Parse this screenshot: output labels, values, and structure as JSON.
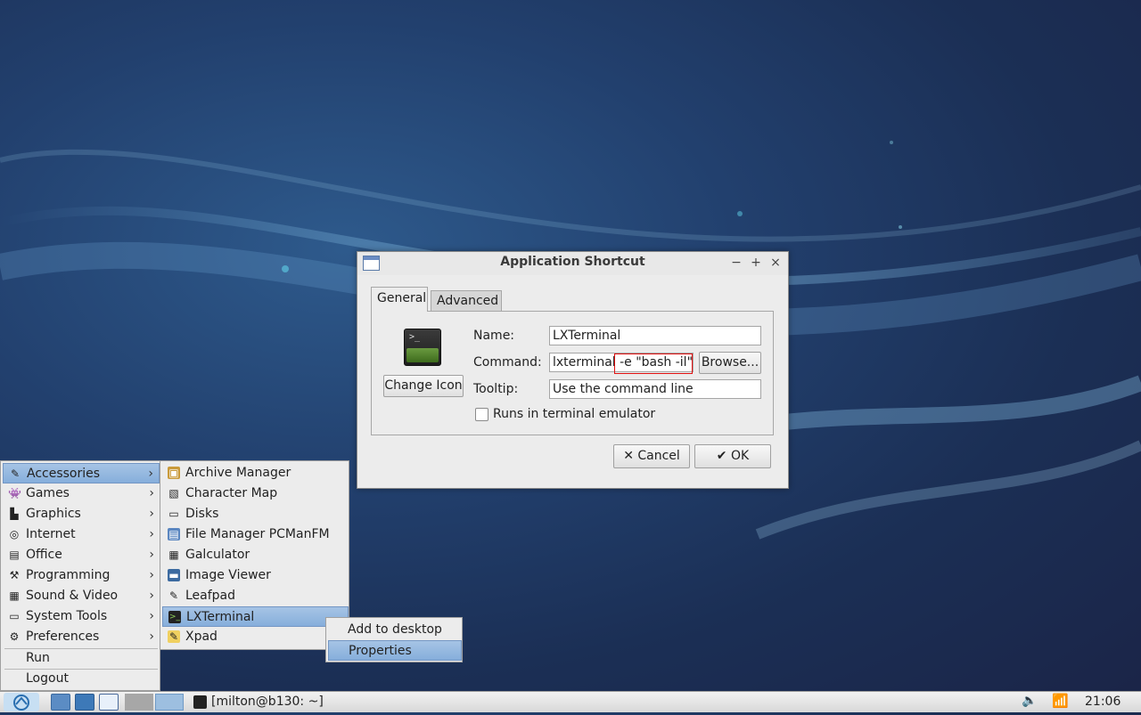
{
  "dialog": {
    "title": "Application Shortcut",
    "controls": {
      "minimize": "−",
      "maximize": "+",
      "close": "×"
    },
    "tabs": [
      {
        "label": "General"
      },
      {
        "label": "Advanced"
      }
    ],
    "change_icon_label": "Change Icon",
    "name_label": "Name:",
    "name_value": "LXTerminal",
    "command_label": "Command:",
    "command_value": "lxterminal -e \"bash -il\"",
    "browse_label": "Browse...",
    "tooltip_label": "Tooltip:",
    "tooltip_value": "Use the command line",
    "run_in_terminal_label": "Runs in terminal emulator",
    "run_in_terminal_checked": false,
    "cancel_label": "Cancel",
    "ok_label": "OK",
    "icon_prompt": ">_"
  },
  "main_menu": {
    "items": [
      {
        "label": "Accessories",
        "icon": "accessories-icon"
      },
      {
        "label": "Games",
        "icon": "games-icon"
      },
      {
        "label": "Graphics",
        "icon": "graphics-icon"
      },
      {
        "label": "Internet",
        "icon": "internet-icon"
      },
      {
        "label": "Office",
        "icon": "office-icon"
      },
      {
        "label": "Programming",
        "icon": "programming-icon"
      },
      {
        "label": "Sound & Video",
        "icon": "sound-video-icon"
      },
      {
        "label": "System Tools",
        "icon": "system-tools-icon"
      },
      {
        "label": "Preferences",
        "icon": "preferences-icon"
      },
      {
        "label": "Run"
      },
      {
        "label": "Logout"
      }
    ],
    "selected": "Accessories"
  },
  "accessories_menu": {
    "items": [
      {
        "label": "Archive Manager",
        "icon": "archive-manager-icon"
      },
      {
        "label": "Character Map",
        "icon": "character-map-icon"
      },
      {
        "label": "Disks",
        "icon": "disks-icon"
      },
      {
        "label": "File Manager PCManFM",
        "icon": "file-manager-icon"
      },
      {
        "label": "Galculator",
        "icon": "calculator-icon"
      },
      {
        "label": "Image Viewer",
        "icon": "image-viewer-icon"
      },
      {
        "label": "Leafpad",
        "icon": "leafpad-icon"
      },
      {
        "label": "LXTerminal",
        "icon": "terminal-icon"
      },
      {
        "label": "Xpad",
        "icon": "xpad-icon"
      }
    ],
    "selected": "LXTerminal"
  },
  "context_menu": {
    "items": [
      {
        "label": "Add to desktop"
      },
      {
        "label": "Properties"
      }
    ],
    "selected": "Properties"
  },
  "taskbar": {
    "task_label": "[milton@b130: ~]",
    "clock": "21:06"
  },
  "colors": {
    "selection": "#86aedb",
    "highlight_box": "#e01010",
    "desktop": "#22406e"
  }
}
